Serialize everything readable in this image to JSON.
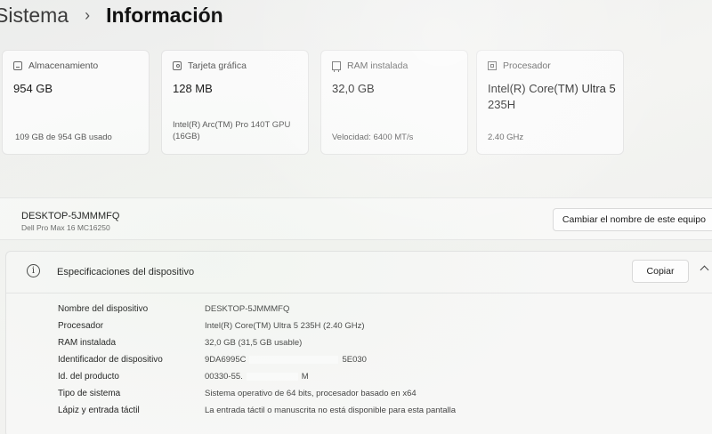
{
  "breadcrumb": {
    "parent": "Sistema",
    "separator": "›",
    "current": "Información"
  },
  "cards": [
    {
      "icon": "storage-icon",
      "label": "Almacenamiento",
      "value": "954 GB",
      "detail": "109 GB de 954 GB usado"
    },
    {
      "icon": "gpu-icon",
      "label": "Tarjeta gráfica",
      "value": "128 MB",
      "detail": "Intel(R) Arc(TM) Pro 140T GPU (16GB)"
    },
    {
      "icon": "ram-icon",
      "label": "RAM instalada",
      "value": "32,0 GB",
      "detail": "Velocidad: 6400 MT/s"
    },
    {
      "icon": "cpu-icon",
      "label": "Procesador",
      "value": "Intel(R) Core(TM) Ultra 5 235H",
      "detail": "2.40 GHz"
    }
  ],
  "device": {
    "name": "DESKTOP-5JMMMFQ",
    "model": "Dell Pro Max 16 MC16250",
    "rename_label": "Cambiar el nombre de este equipo"
  },
  "specs": {
    "title": "Especificaciones del dispositivo",
    "copy_label": "Copiar",
    "rows": [
      {
        "label": "Nombre del dispositivo",
        "value": "DESKTOP-5JMMMFQ"
      },
      {
        "label": "Procesador",
        "value": "Intel(R) Core(TM) Ultra 5 235H (2.40 GHz)"
      },
      {
        "label": "RAM instalada",
        "value": "32,0 GB (31,5 GB usable)"
      },
      {
        "label": "Identificador de dispositivo",
        "value": "9DA6995C",
        "value_tail": "5E030"
      },
      {
        "label": "Id. del producto",
        "value": "00330-55.",
        "value_tail": "M"
      },
      {
        "label": "Tipo de sistema",
        "value": "Sistema operativo de 64 bits, procesador basado en x64"
      },
      {
        "label": "Lápiz y entrada táctil",
        "value": "La entrada táctil o manuscrita no está disponible para esta pantalla"
      }
    ]
  }
}
